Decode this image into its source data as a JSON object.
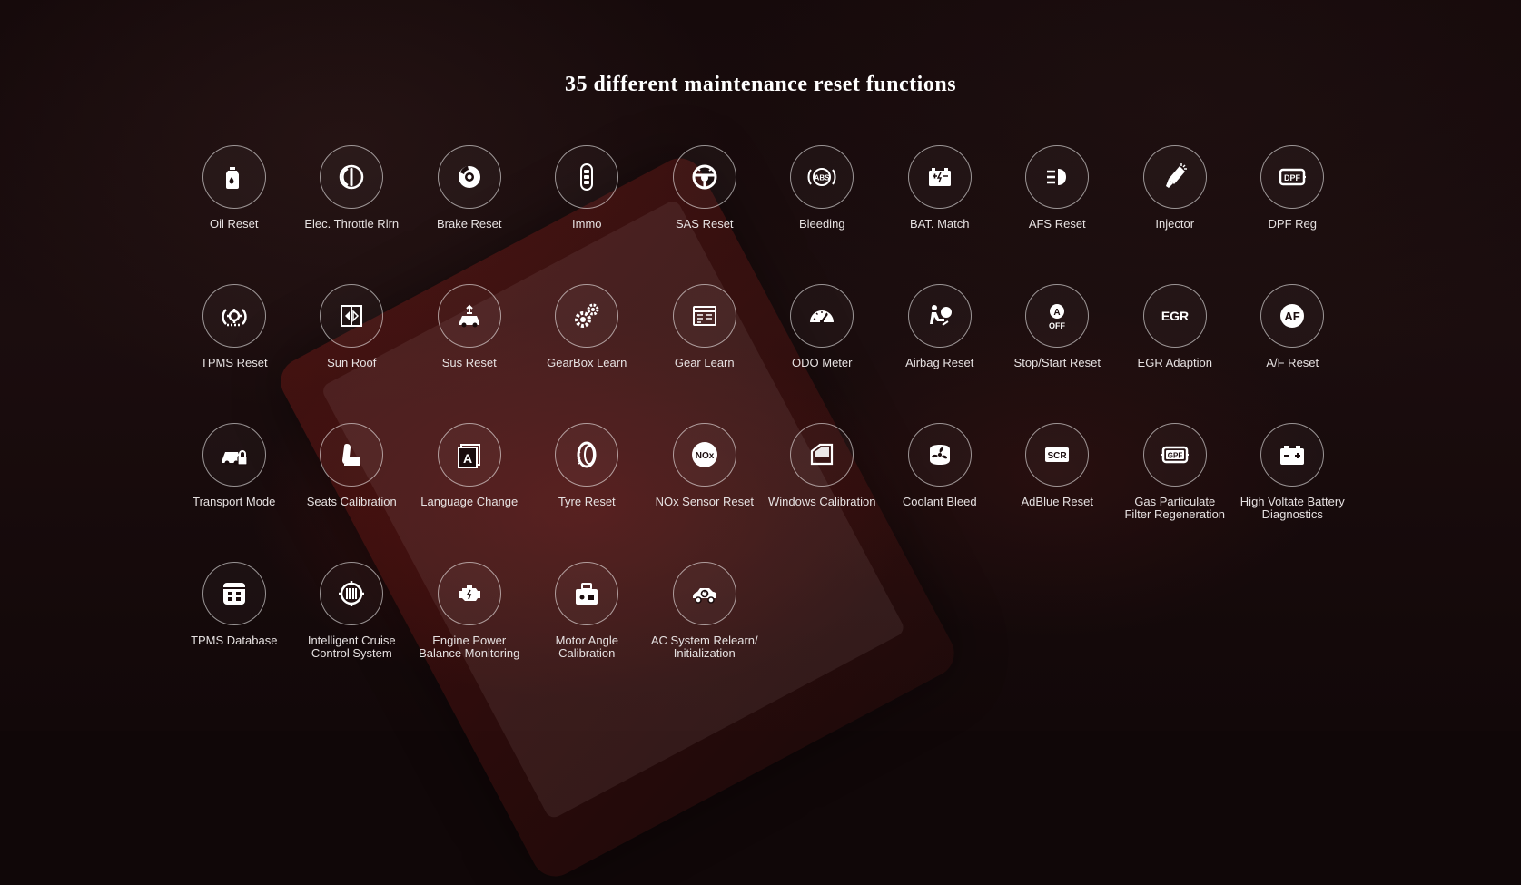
{
  "title": "35 different maintenance reset functions",
  "functions": [
    {
      "label": "Oil Reset",
      "icon": "oil-can-icon"
    },
    {
      "label": "Elec. Throttle Rlrn",
      "icon": "throttle-icon"
    },
    {
      "label": "Brake Reset",
      "icon": "brake-disc-icon"
    },
    {
      "label": "Immo",
      "icon": "key-fob-icon"
    },
    {
      "label": "SAS Reset",
      "icon": "steering-wheel-icon"
    },
    {
      "label": "Bleeding",
      "icon": "abs-icon"
    },
    {
      "label": "BAT. Match",
      "icon": "battery-icon"
    },
    {
      "label": "AFS Reset",
      "icon": "headlight-icon"
    },
    {
      "label": "Injector",
      "icon": "injector-icon"
    },
    {
      "label": "DPF Reg",
      "icon": "dpf-icon"
    },
    {
      "label": "TPMS Reset",
      "icon": "tire-pressure-icon"
    },
    {
      "label": "Sun Roof",
      "icon": "sunroof-icon"
    },
    {
      "label": "Sus Reset",
      "icon": "suspension-icon"
    },
    {
      "label": "GearBox Learn",
      "icon": "gears-icon"
    },
    {
      "label": "Gear Learn",
      "icon": "gear-learn-icon"
    },
    {
      "label": "ODO Meter",
      "icon": "odometer-icon"
    },
    {
      "label": "Airbag Reset",
      "icon": "airbag-icon"
    },
    {
      "label": "Stop/Start Reset",
      "icon": "auto-stop-off-icon"
    },
    {
      "label": "EGR Adaption",
      "icon": "egr-icon"
    },
    {
      "label": "A/F Reset",
      "icon": "af-icon"
    },
    {
      "label": "Transport Mode",
      "icon": "transport-mode-icon"
    },
    {
      "label": "Seats Calibration",
      "icon": "seat-icon"
    },
    {
      "label": "Language Change",
      "icon": "language-icon"
    },
    {
      "label": "Tyre Reset",
      "icon": "tyre-icon"
    },
    {
      "label": "NOx Sensor Reset",
      "icon": "nox-sensor-icon"
    },
    {
      "label": "Windows Calibration",
      "icon": "window-icon"
    },
    {
      "label": "Coolant Bleed",
      "icon": "coolant-fan-icon"
    },
    {
      "label": "AdBlue Reset",
      "icon": "scr-icon"
    },
    {
      "label": "Gas Particulate\nFilter Regeneration",
      "icon": "gpf-icon"
    },
    {
      "label": "High Voltate Battery\nDiagnostics",
      "icon": "hv-battery-icon"
    },
    {
      "label": "TPMS Database",
      "icon": "database-icon"
    },
    {
      "label": "Intelligent Cruise\nControl System",
      "icon": "cruise-control-icon"
    },
    {
      "label": "Engine Power\nBalance Monitoring",
      "icon": "engine-icon"
    },
    {
      "label": "Motor Angle\nCalibration",
      "icon": "motor-angle-icon"
    },
    {
      "label": "AC System Relearn/\nInitialization",
      "icon": "ac-system-icon"
    }
  ]
}
